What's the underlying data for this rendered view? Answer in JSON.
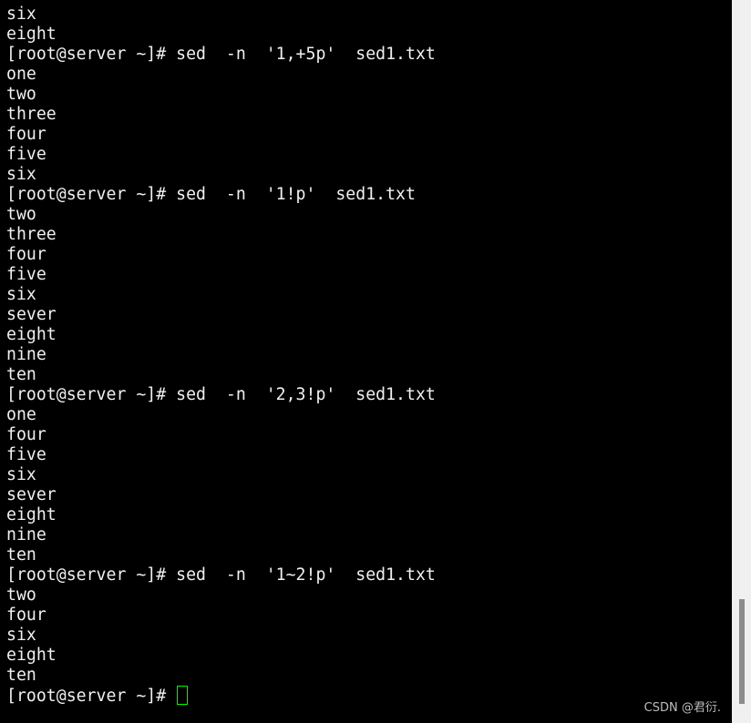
{
  "terminal": {
    "lines": [
      "six",
      "eight",
      "[root@server ~]# sed  -n  '1,+5p'  sed1.txt",
      "one",
      "two",
      "three",
      "four",
      "five",
      "six",
      "[root@server ~]# sed  -n  '1!p'  sed1.txt",
      "two",
      "three",
      "four",
      "five",
      "six",
      "sever",
      "eight",
      "nine",
      "ten",
      "[root@server ~]# sed  -n  '2,3!p'  sed1.txt",
      "one",
      "four",
      "five",
      "six",
      "sever",
      "eight",
      "nine",
      "ten",
      "[root@server ~]# sed  -n  '1~2!p'  sed1.txt",
      "two",
      "four",
      "six",
      "eight",
      "ten"
    ],
    "prompt": "[root@server ~]# ",
    "cursor_color": "#00ff00"
  },
  "watermark": "CSDN @君衍.",
  "scrollbar": {
    "position_fraction": 1.0
  }
}
